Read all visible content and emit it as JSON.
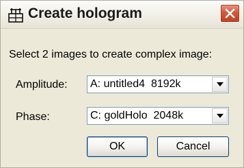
{
  "window": {
    "title": "Create hologram",
    "icon": "hologram-app-icon",
    "close_icon": "close-x-icon"
  },
  "prompt": "Select 2 images to create complex image:",
  "fields": {
    "amplitude": {
      "label": "Amplitude:",
      "value": "A: untitled4  8192k"
    },
    "phase": {
      "label": "Phase:",
      "value": "C: goldHolo  2048k"
    }
  },
  "buttons": {
    "ok": "OK",
    "cancel": "Cancel"
  },
  "colors": {
    "dialog_bg": "#ece9d8",
    "close_button": "#d25a3c",
    "field_border": "#7f9db9"
  }
}
